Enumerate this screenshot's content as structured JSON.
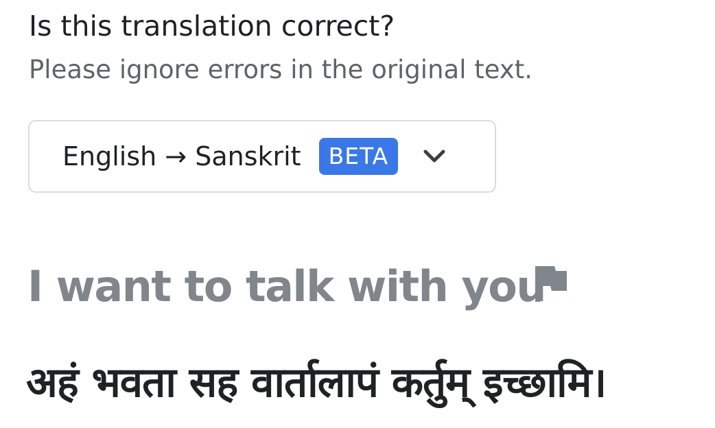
{
  "question": {
    "title": "Is this translation correct?",
    "subtitle": "Please ignore errors in the original text."
  },
  "language_selector": {
    "label": "English → Sanskrit",
    "badge": "BETA",
    "badge_color": "#3b78e7",
    "icon": "chevron-down-icon"
  },
  "source": {
    "text": "I want to talk with you",
    "icon": "flag-icon"
  },
  "translation": {
    "text": "अहं भवता सह वार्तालापं कर्तुम् इच्छामि।"
  }
}
